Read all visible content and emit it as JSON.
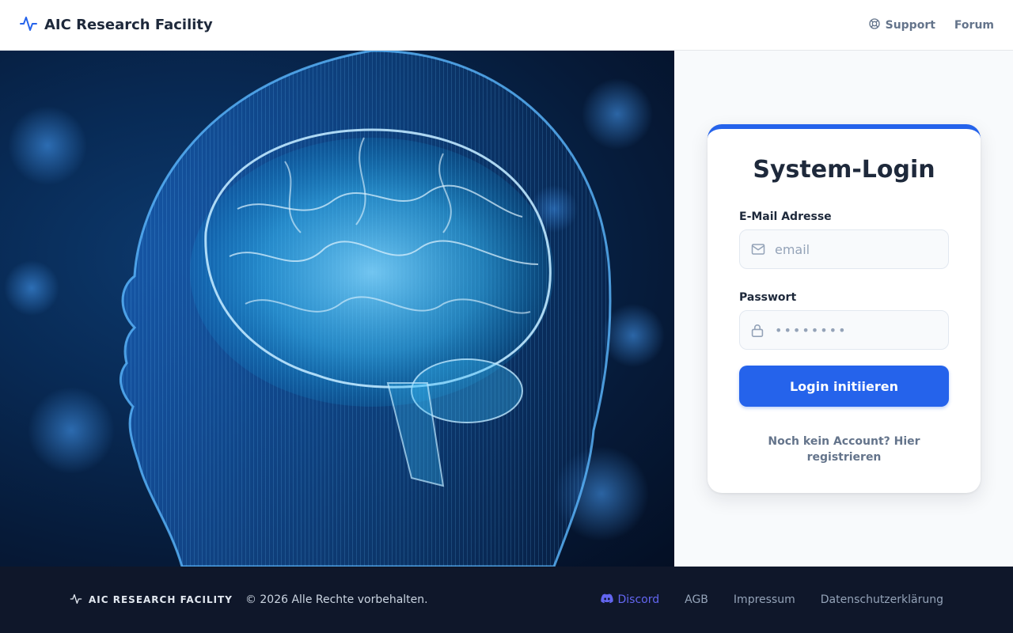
{
  "header": {
    "brand": "AIC Research Facility",
    "brand_icon": "activity-pulse-icon",
    "nav": [
      {
        "label": "Support",
        "icon": "lifebuoy-icon"
      },
      {
        "label": "Forum"
      }
    ]
  },
  "login": {
    "title": "System-Login",
    "email_label": "E-Mail Adresse",
    "email_placeholder": "email",
    "password_label": "Passwort",
    "password_value": "••••••••",
    "submit_label": "Login initiieren",
    "register_text": "Noch kein Account? Hier registrieren"
  },
  "footer": {
    "brand": "AIC RESEARCH FACILITY",
    "copyright": "© 2026 Alle Rechte vorbehalten.",
    "links": [
      {
        "label": "Discord",
        "icon": "discord-icon"
      },
      {
        "label": "AGB"
      },
      {
        "label": "Impressum"
      },
      {
        "label": "Datenschutzerklärung"
      }
    ]
  },
  "colors": {
    "accent": "#2563eb",
    "footer_bg": "#0f172a",
    "discord": "#6366f1",
    "hero_glow": "#38bdf8"
  }
}
